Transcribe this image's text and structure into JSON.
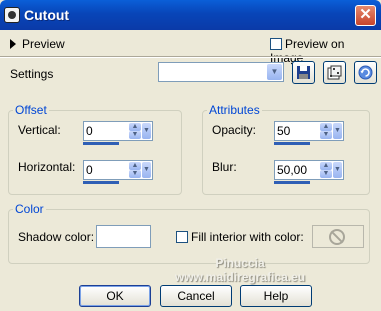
{
  "window": {
    "title": "Cutout",
    "close_glyph": "✕"
  },
  "preview": {
    "toggle_label": "Preview",
    "preview_on_image_label": "Preview on Image"
  },
  "settings": {
    "label": "Settings",
    "selected": "",
    "save_icon": "floppy-disk-icon",
    "randomize_icon": "dice-icon",
    "reset_icon": "reset-icon"
  },
  "offset": {
    "legend": "Offset",
    "vertical_label": "Vertical:",
    "vertical_value": "0",
    "horizontal_label": "Horizontal:",
    "horizontal_value": "0"
  },
  "attributes": {
    "legend": "Attributes",
    "opacity_label": "Opacity:",
    "opacity_value": "50",
    "blur_label": "Blur:",
    "blur_value": "50,00"
  },
  "color": {
    "legend": "Color",
    "shadow_label": "Shadow color:",
    "shadow_color": "#ffffff",
    "fill_label": "Fill interior with color:"
  },
  "watermark": {
    "line1": "Pinuccia",
    "line2": "www.maidiregrafica.eu"
  },
  "buttons": {
    "ok": "OK",
    "cancel": "Cancel",
    "help": "Help"
  }
}
